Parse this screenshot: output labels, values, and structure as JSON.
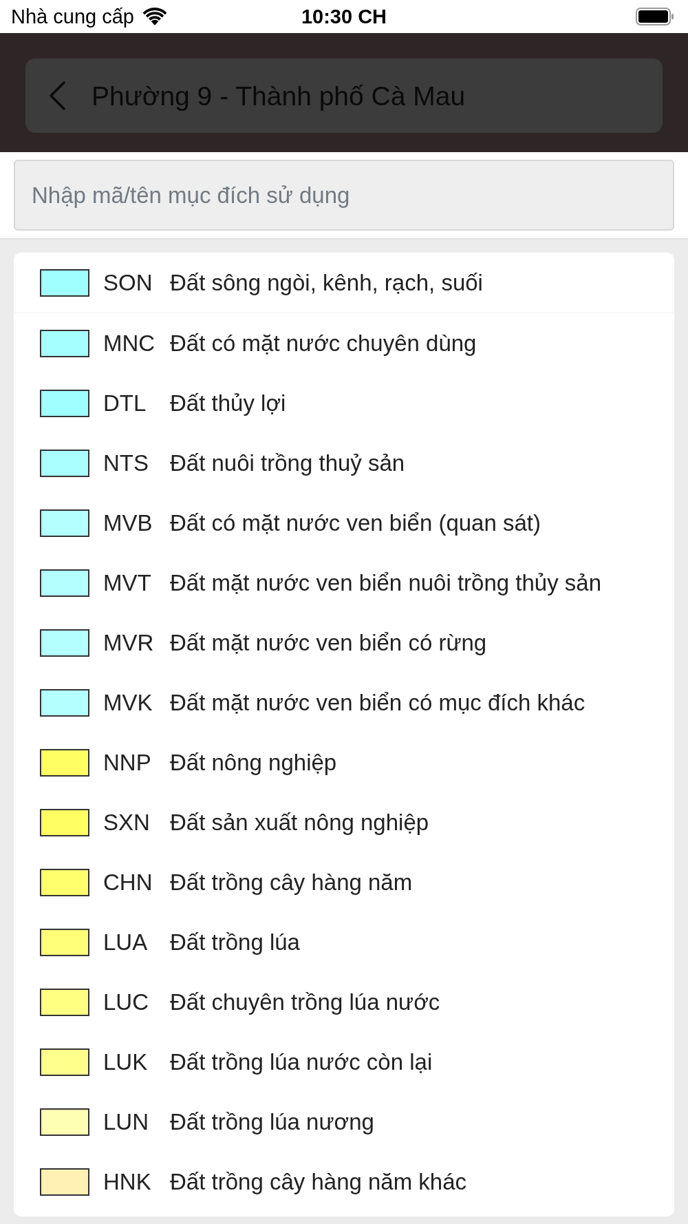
{
  "status_bar": {
    "carrier": "Nhà cung cấp",
    "time": "10:30 CH"
  },
  "header": {
    "title": "Phường 9 - Thành phố Cà Mau"
  },
  "search": {
    "placeholder": "Nhập mã/tên mục đích sử dụng"
  },
  "legend": [
    {
      "code": "SON",
      "name": "Đất sông ngòi, kênh, rạch, suối",
      "color": "#a0ffff"
    },
    {
      "code": "MNC",
      "name": "Đất có mặt nước chuyên dùng",
      "color": "#a6ffff"
    },
    {
      "code": "DTL",
      "name": "Đất thủy lợi",
      "color": "#a0ffff"
    },
    {
      "code": "NTS",
      "name": "Đất nuôi trồng thuỷ sản",
      "color": "#aaffff"
    },
    {
      "code": "MVB",
      "name": "Đất có mặt nước ven biển (quan sát)",
      "color": "#b4ffff"
    },
    {
      "code": "MVT",
      "name": "Đất mặt nước ven biển nuôi trồng thủy sản",
      "color": "#b4ffff"
    },
    {
      "code": "MVR",
      "name": "Đất mặt nước ven biển có rừng",
      "color": "#b4ffff"
    },
    {
      "code": "MVK",
      "name": "Đất mặt nước ven biển có mục đích khác",
      "color": "#b4ffff"
    },
    {
      "code": "NNP",
      "name": "Đất nông nghiệp",
      "color": "#ffff64"
    },
    {
      "code": "SXN",
      "name": "Đất sản xuất nông nghiệp",
      "color": "#ffff64"
    },
    {
      "code": "CHN",
      "name": "Đất trồng cây hàng năm",
      "color": "#ffff6e"
    },
    {
      "code": "LUA",
      "name": "Đất trồng lúa",
      "color": "#ffff78"
    },
    {
      "code": "LUC",
      "name": "Đất chuyên trồng lúa nước",
      "color": "#ffff82"
    },
    {
      "code": "LUK",
      "name": "Đất trồng lúa nước còn lại",
      "color": "#ffff8c"
    },
    {
      "code": "LUN",
      "name": "Đất trồng lúa nương",
      "color": "#ffffb4"
    },
    {
      "code": "HNK",
      "name": "Đất trồng cây hàng năm khác",
      "color": "#fff0b4"
    }
  ]
}
